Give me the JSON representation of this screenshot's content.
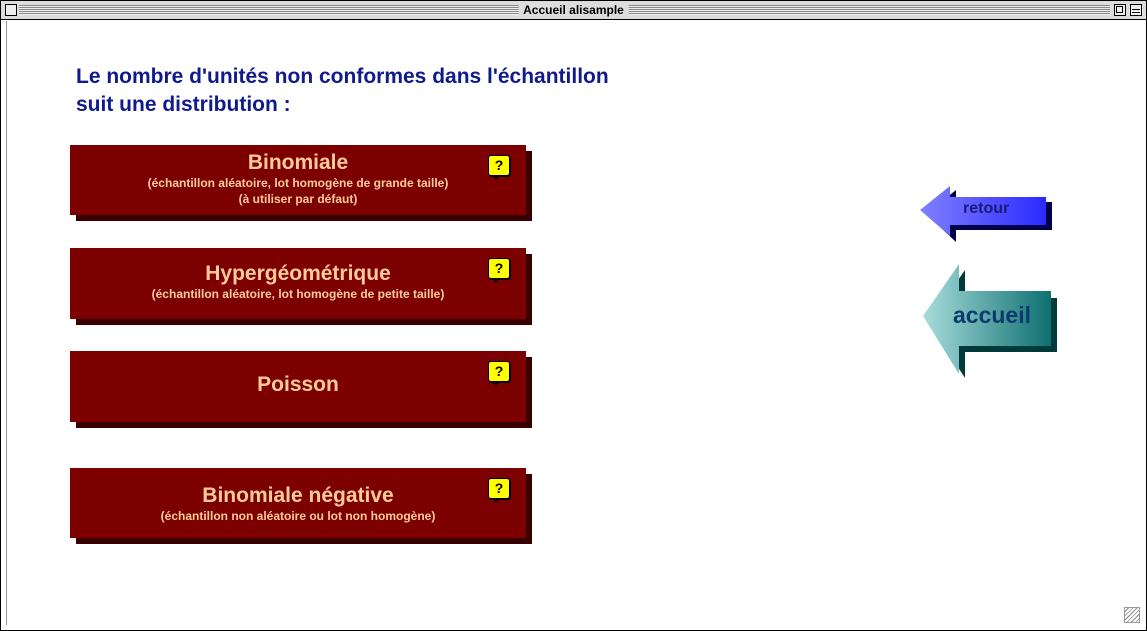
{
  "window": {
    "title": "Accueil alisample"
  },
  "heading": {
    "line1": "Le nombre d'unités non conformes dans l'échantillon",
    "line2": "suit une distribution :"
  },
  "distributions": [
    {
      "name": "Binomiale",
      "details": [
        "(échantillon aléatoire, lot homogène de grande taille)",
        "(à utiliser par défaut)"
      ],
      "help_icon": "?"
    },
    {
      "name": "Hypergéométrique",
      "details": [
        "(échantillon aléatoire, lot homogène de petite taille)"
      ],
      "help_icon": "?"
    },
    {
      "name": "Poisson",
      "details": [],
      "help_icon": "?"
    },
    {
      "name": "Binomiale négative",
      "details": [
        "(échantillon non aléatoire ou lot non homogène)"
      ],
      "help_icon": "?"
    }
  ],
  "nav": {
    "retour_label": "retour",
    "accueil_label": "accueil"
  },
  "colors": {
    "heading": "#0f1a8c",
    "button_bg": "#7d0000",
    "button_text": "#ffcc99",
    "help_bg": "#ffff00",
    "retour_arrow": "#4a4aff",
    "accueil_arrow": "#1a8a8a"
  },
  "icons": {
    "help": "help-bubble-icon",
    "retour": "arrow-left-icon",
    "accueil": "arrow-left-icon"
  }
}
